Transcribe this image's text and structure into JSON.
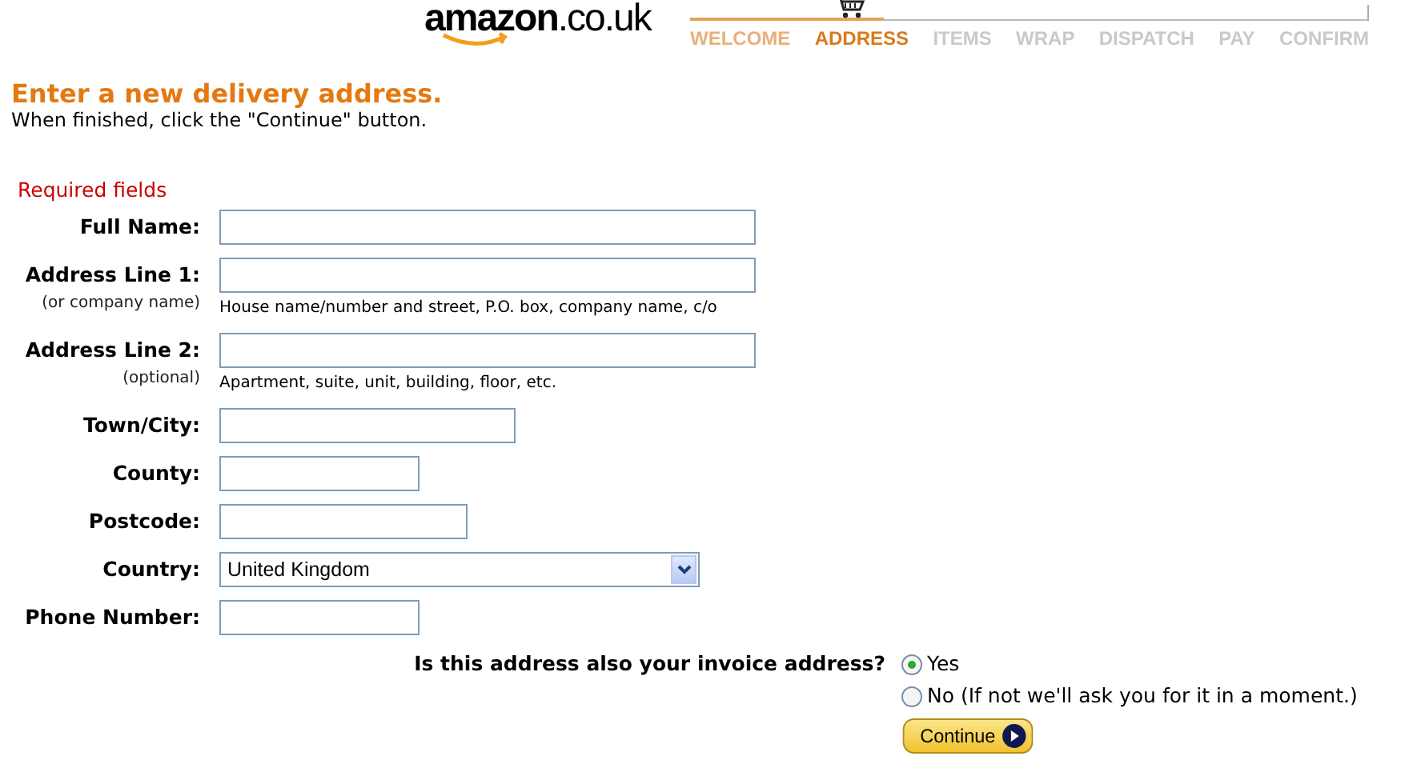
{
  "header": {
    "logo": {
      "name": "amazon",
      "suffix": ".co.uk"
    },
    "steps": [
      {
        "label": "WELCOME",
        "selected": false,
        "done": true
      },
      {
        "label": "ADDRESS",
        "selected": true,
        "done": true
      },
      {
        "label": "ITEMS",
        "selected": false,
        "done": false
      },
      {
        "label": "WRAP",
        "selected": false,
        "done": false
      },
      {
        "label": "DISPATCH",
        "selected": false,
        "done": false
      },
      {
        "label": "PAY",
        "selected": false,
        "done": false
      },
      {
        "label": "CONFIRM",
        "selected": false,
        "done": false
      }
    ]
  },
  "title": "Enter a new delivery address.",
  "subtitle": "When finished, click the \"Continue\" button.",
  "required_note": "Required fields",
  "fields": [
    {
      "label": "Full Name:",
      "kind": "text"
    },
    {
      "label": "Address Line 1:",
      "sublabel": "(or company name)",
      "hint": "House name/number and street, P.O. box, company name, c/o",
      "kind": "text"
    },
    {
      "label": "Address Line 2:",
      "sublabel": "(optional)",
      "hint": "Apartment, suite, unit, building, floor, etc.",
      "kind": "text"
    },
    {
      "label": "Town/City:",
      "kind": "text"
    },
    {
      "label": "County:",
      "kind": "text"
    },
    {
      "label": "Postcode:",
      "kind": "text"
    },
    {
      "label": "Country:",
      "kind": "select",
      "value": "United Kingdom"
    },
    {
      "label": "Phone Number:",
      "kind": "text"
    }
  ],
  "invoice_question": {
    "label": "Is this address also your invoice address?",
    "options": [
      {
        "label": "Yes",
        "selected": true
      },
      {
        "label": "No (If not we'll ask you for it in a moment.)",
        "selected": false
      }
    ]
  },
  "continue_button": "Continue"
}
